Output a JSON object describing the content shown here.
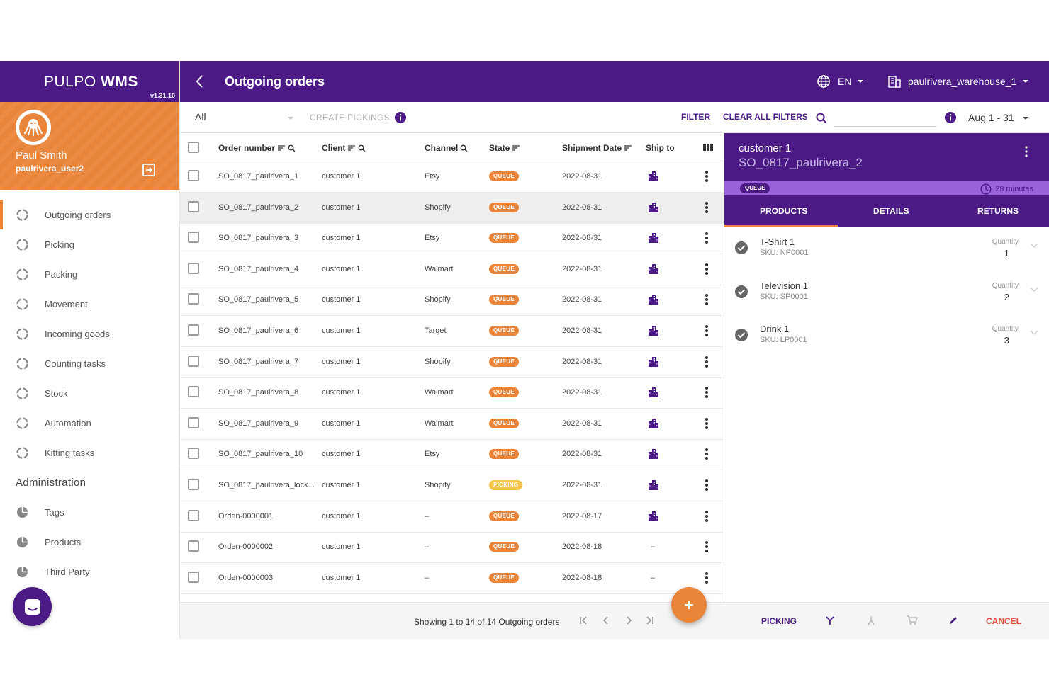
{
  "brand": {
    "name_light": "PULPO ",
    "name_bold": "WMS",
    "version": "v1.31.10"
  },
  "user": {
    "full_name": "Paul Smith",
    "username": "paulrivera_user2"
  },
  "nav": {
    "items": [
      {
        "label": "Outgoing orders"
      },
      {
        "label": "Picking"
      },
      {
        "label": "Packing"
      },
      {
        "label": "Movement"
      },
      {
        "label": "Incoming goods"
      },
      {
        "label": "Counting tasks"
      },
      {
        "label": "Stock"
      },
      {
        "label": "Automation"
      },
      {
        "label": "Kitting tasks"
      }
    ],
    "admin_title": "Administration",
    "admin_items": [
      {
        "label": "Tags"
      },
      {
        "label": "Products"
      },
      {
        "label": "Third Party"
      }
    ]
  },
  "topbar": {
    "title": "Outgoing orders",
    "language": "EN",
    "warehouse": "paulrivera_warehouse_1"
  },
  "toolbar": {
    "select_value": "All",
    "create_pickings": "CREATE PICKINGS",
    "filter": "FILTER",
    "clear_filters": "CLEAR ALL FILTERS",
    "date_range": "Aug 1 - 31"
  },
  "table": {
    "columns": [
      "Order number",
      "Client",
      "Channel",
      "State",
      "Shipment Date",
      "Ship to"
    ],
    "rows": [
      {
        "order": "SO_0817_paulrivera_1",
        "client": "customer 1",
        "channel": "Etsy",
        "state": "QUEUE",
        "date": "2022-08-31",
        "ship": "building"
      },
      {
        "order": "SO_0817_paulrivera_2",
        "client": "customer 1",
        "channel": "Shopify",
        "state": "QUEUE",
        "date": "2022-08-31",
        "ship": "building"
      },
      {
        "order": "SO_0817_paulrivera_3",
        "client": "customer 1",
        "channel": "Etsy",
        "state": "QUEUE",
        "date": "2022-08-31",
        "ship": "building"
      },
      {
        "order": "SO_0817_paulrivera_4",
        "client": "customer 1",
        "channel": "Walmart",
        "state": "QUEUE",
        "date": "2022-08-31",
        "ship": "building"
      },
      {
        "order": "SO_0817_paulrivera_5",
        "client": "customer 1",
        "channel": "Shopify",
        "state": "QUEUE",
        "date": "2022-08-31",
        "ship": "building"
      },
      {
        "order": "SO_0817_paulrivera_6",
        "client": "customer 1",
        "channel": "Target",
        "state": "QUEUE",
        "date": "2022-08-31",
        "ship": "building"
      },
      {
        "order": "SO_0817_paulrivera_7",
        "client": "customer 1",
        "channel": "Shopify",
        "state": "QUEUE",
        "date": "2022-08-31",
        "ship": "building"
      },
      {
        "order": "SO_0817_paulrivera_8",
        "client": "customer 1",
        "channel": "Walmart",
        "state": "QUEUE",
        "date": "2022-08-31",
        "ship": "building"
      },
      {
        "order": "SO_0817_paulrivera_9",
        "client": "customer 1",
        "channel": "Walmart",
        "state": "QUEUE",
        "date": "2022-08-31",
        "ship": "building"
      },
      {
        "order": "SO_0817_paulrivera_10",
        "client": "customer 1",
        "channel": "Etsy",
        "state": "QUEUE",
        "date": "2022-08-31",
        "ship": "building"
      },
      {
        "order": "SO_0817_paulrivera_lock...",
        "client": "customer 1",
        "channel": "Shopify",
        "state": "PICKING",
        "date": "2022-08-31",
        "ship": "building"
      },
      {
        "order": "Orden-0000001",
        "client": "customer 1",
        "channel": "–",
        "state": "QUEUE",
        "date": "2022-08-17",
        "ship": "building"
      },
      {
        "order": "Orden-0000002",
        "client": "customer 1",
        "channel": "–",
        "state": "QUEUE",
        "date": "2022-08-18",
        "ship": "–"
      },
      {
        "order": "Orden-0000003",
        "client": "customer 1",
        "channel": "–",
        "state": "QUEUE",
        "date": "2022-08-18",
        "ship": "–"
      }
    ]
  },
  "footer": {
    "showing": "Showing 1 to 14 of 14 Outgoing orders",
    "picking": "PICKING",
    "cancel": "CANCEL"
  },
  "detail": {
    "customer": "customer 1",
    "order": "SO_0817_paulrivera_2",
    "state": "QUEUE",
    "time": "29 minutes",
    "tabs": [
      "PRODUCTS",
      "DETAILS",
      "RETURNS"
    ],
    "products": [
      {
        "name": "T-Shirt 1",
        "sku": "SKU: NP0001",
        "qty_label": "Quantity",
        "qty": "1"
      },
      {
        "name": "Television 1",
        "sku": "SKU: SP0001",
        "qty_label": "Quantity",
        "qty": "2"
      },
      {
        "name": "Drink 1",
        "sku": "SKU: LP0001",
        "qty_label": "Quantity",
        "qty": "3"
      }
    ]
  },
  "colors": {
    "primary": "#4b1a84",
    "accent": "#e9853a",
    "picking": "#f3c54a",
    "danger": "#e04b3a"
  }
}
